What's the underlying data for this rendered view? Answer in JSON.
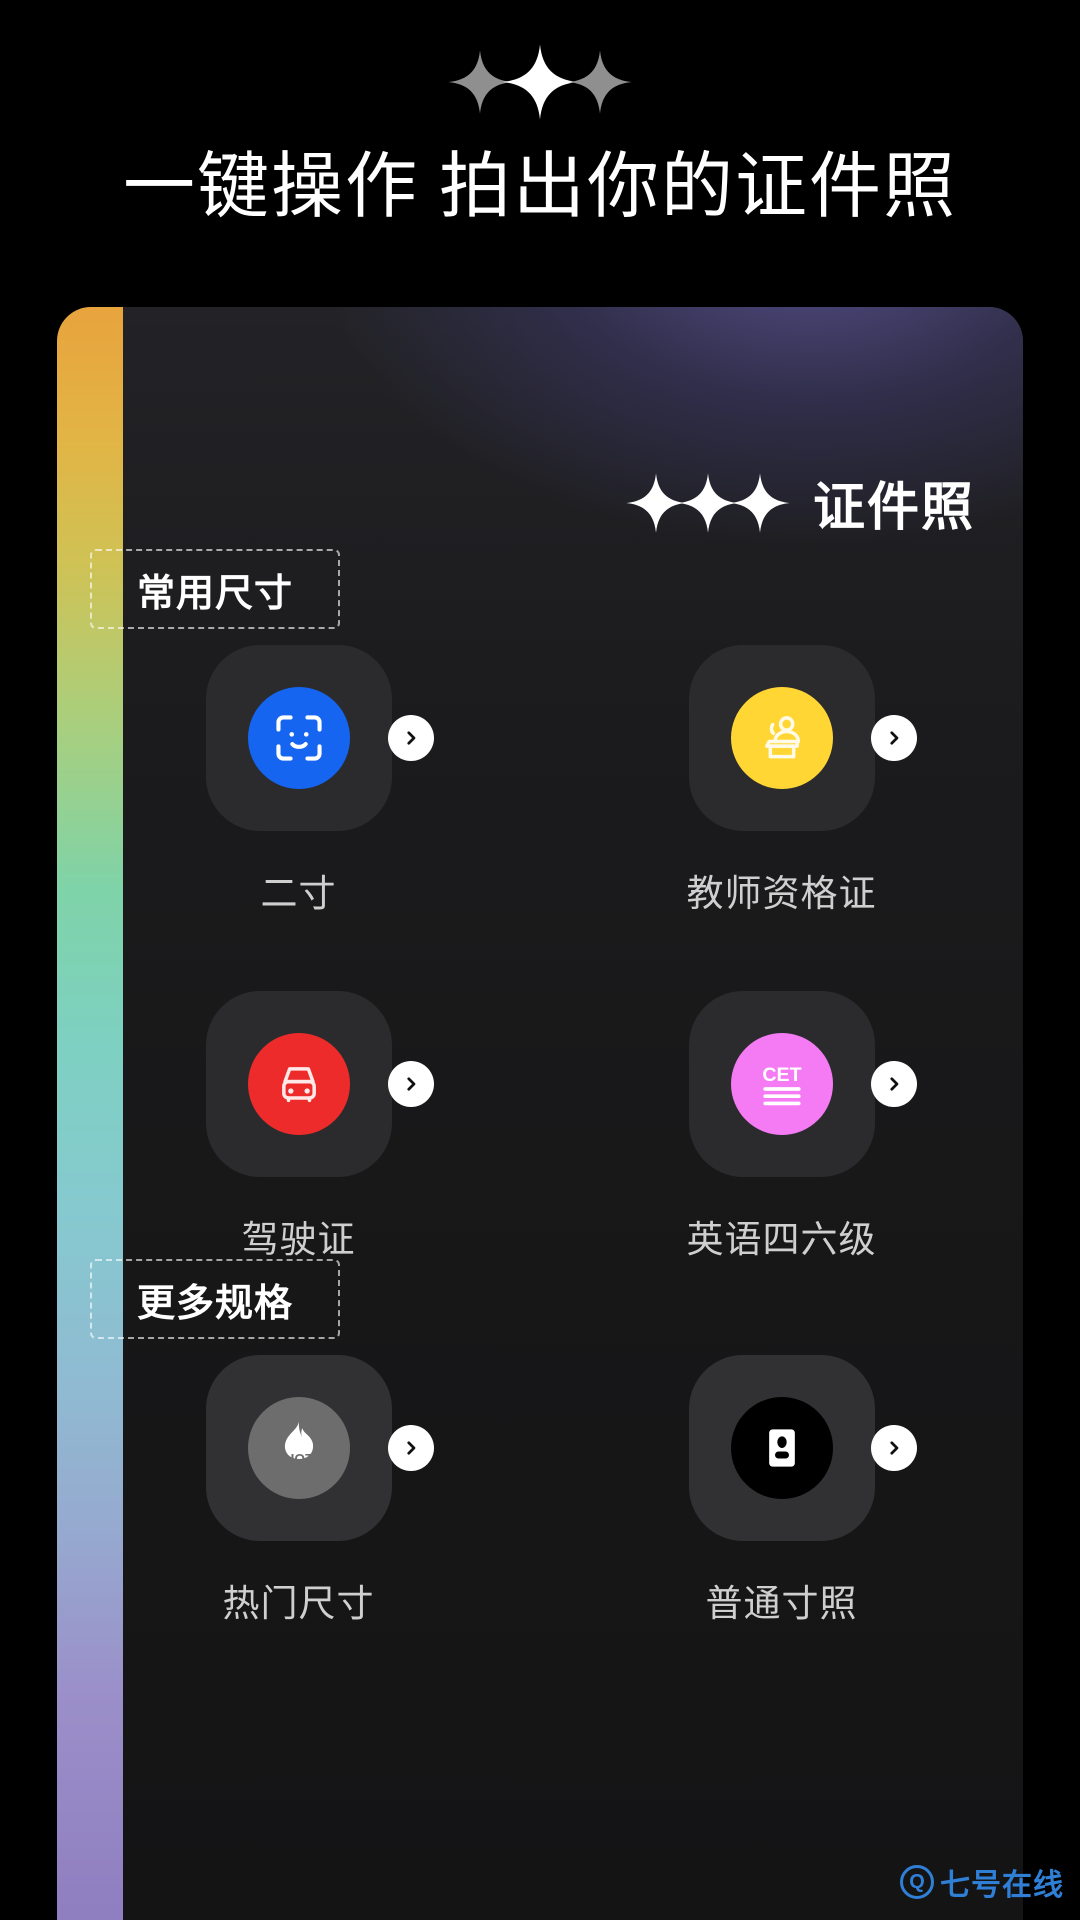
{
  "hero": {
    "sparkles": [
      "sparkle-dim",
      "sparkle-bright",
      "sparkle-dim"
    ],
    "title": "一键操作 拍出你的证件照"
  },
  "card": {
    "header": {
      "title": "证件照",
      "sparkles": [
        "sparkle-icon",
        "sparkle-icon",
        "sparkle-icon"
      ]
    },
    "sections": [
      {
        "label": "常用尺寸",
        "items": [
          {
            "label": "二寸",
            "icon": "face-id-icon",
            "color": "#1565F0",
            "chevron": "chevron-right-icon"
          },
          {
            "label": "教师资格证",
            "icon": "teacher-podium-icon",
            "color": "#FFD633",
            "chevron": "chevron-right-icon"
          },
          {
            "label": "驾驶证",
            "icon": "car-icon",
            "color": "#EE2B2B",
            "chevron": "chevron-right-icon"
          },
          {
            "label": "英语四六级",
            "icon": "cet-icon",
            "color": "#F munge",
            "chevron": "chevron-right-icon"
          }
        ]
      },
      {
        "label": "更多规格",
        "items": [
          {
            "label": "热门尺寸",
            "icon": "hot-flame-icon",
            "color": "#6D6D6D",
            "chevron": "chevron-right-icon"
          },
          {
            "label": "普通寸照",
            "icon": "id-card-person-icon",
            "color": "#000000",
            "chevron": "chevron-right-icon"
          }
        ]
      }
    ]
  },
  "watermark": {
    "mark": "Q",
    "text": "七号在线",
    "color": "#2F7FD6"
  }
}
